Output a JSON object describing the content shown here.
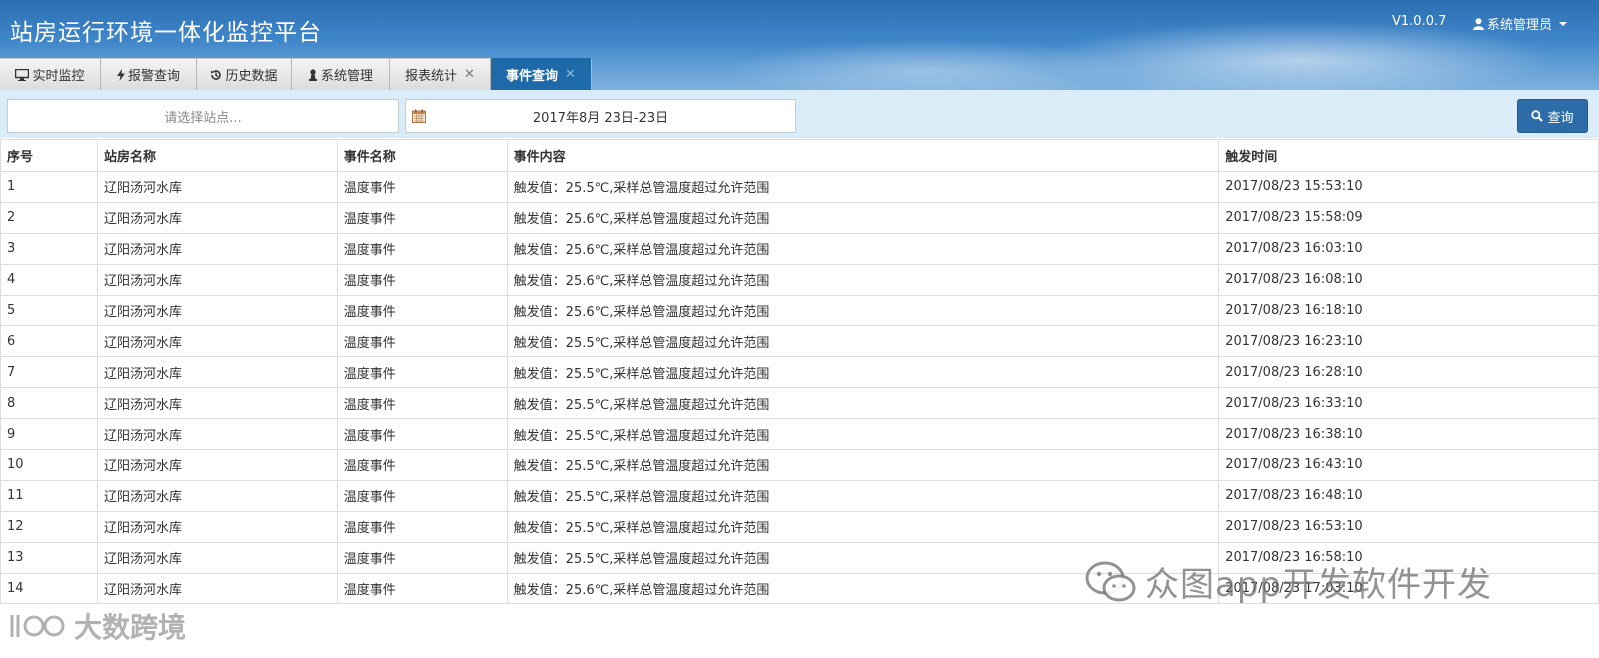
{
  "header": {
    "title": "站房运行环境一体化监控平台",
    "version": "V1.0.0.7",
    "user": "系统管理员"
  },
  "tabs": [
    {
      "label": "实时监控",
      "icon": "monitor-icon",
      "active": false,
      "closable": false
    },
    {
      "label": "报警查询",
      "icon": "bolt-icon",
      "active": false,
      "closable": false
    },
    {
      "label": "历史数据",
      "icon": "history-icon",
      "active": false,
      "closable": false
    },
    {
      "label": "系统管理",
      "icon": "pawn-icon",
      "active": false,
      "closable": false
    },
    {
      "label": "报表统计",
      "icon": "",
      "active": false,
      "closable": true
    },
    {
      "label": "事件查询",
      "icon": "",
      "active": true,
      "closable": true
    }
  ],
  "toolbar": {
    "station_placeholder": "请选择站点...",
    "date_range": "2017年8月 23日-23日",
    "query_label": "查询"
  },
  "table": {
    "columns": [
      "序号",
      "站房名称",
      "事件名称",
      "事件内容",
      "触发时间"
    ],
    "rows": [
      [
        "1",
        "辽阳汤河水库",
        "温度事件",
        "触发值：25.5℃,采样总管温度超过允许范围",
        "2017/08/23 15:53:10"
      ],
      [
        "2",
        "辽阳汤河水库",
        "温度事件",
        "触发值：25.6℃,采样总管温度超过允许范围",
        "2017/08/23 15:58:09"
      ],
      [
        "3",
        "辽阳汤河水库",
        "温度事件",
        "触发值：25.6℃,采样总管温度超过允许范围",
        "2017/08/23 16:03:10"
      ],
      [
        "4",
        "辽阳汤河水库",
        "温度事件",
        "触发值：25.6℃,采样总管温度超过允许范围",
        "2017/08/23 16:08:10"
      ],
      [
        "5",
        "辽阳汤河水库",
        "温度事件",
        "触发值：25.6℃,采样总管温度超过允许范围",
        "2017/08/23 16:18:10"
      ],
      [
        "6",
        "辽阳汤河水库",
        "温度事件",
        "触发值：25.5℃,采样总管温度超过允许范围",
        "2017/08/23 16:23:10"
      ],
      [
        "7",
        "辽阳汤河水库",
        "温度事件",
        "触发值：25.5℃,采样总管温度超过允许范围",
        "2017/08/23 16:28:10"
      ],
      [
        "8",
        "辽阳汤河水库",
        "温度事件",
        "触发值：25.5℃,采样总管温度超过允许范围",
        "2017/08/23 16:33:10"
      ],
      [
        "9",
        "辽阳汤河水库",
        "温度事件",
        "触发值：25.5℃,采样总管温度超过允许范围",
        "2017/08/23 16:38:10"
      ],
      [
        "10",
        "辽阳汤河水库",
        "温度事件",
        "触发值：25.5℃,采样总管温度超过允许范围",
        "2017/08/23 16:43:10"
      ],
      [
        "11",
        "辽阳汤河水库",
        "温度事件",
        "触发值：25.5℃,采样总管温度超过允许范围",
        "2017/08/23 16:48:10"
      ],
      [
        "12",
        "辽阳汤河水库",
        "温度事件",
        "触发值：25.5℃,采样总管温度超过允许范围",
        "2017/08/23 16:53:10"
      ],
      [
        "13",
        "辽阳汤河水库",
        "温度事件",
        "触发值：25.5℃,采样总管温度超过允许范围",
        "2017/08/23 16:58:10"
      ],
      [
        "14",
        "辽阳汤河水库",
        "温度事件",
        "触发值：25.6℃,采样总管温度超过允许范围",
        "2017/08/23 17:03:10"
      ]
    ]
  },
  "watermarks": {
    "wechat": "众图app开发软件开发",
    "brand": "大数跨境"
  },
  "colors": {
    "header_top": "#2d6fb3",
    "active_tab": "#1e6aa8",
    "toolbar_bg": "#d9ecf8",
    "button": "#2d6ca9"
  }
}
